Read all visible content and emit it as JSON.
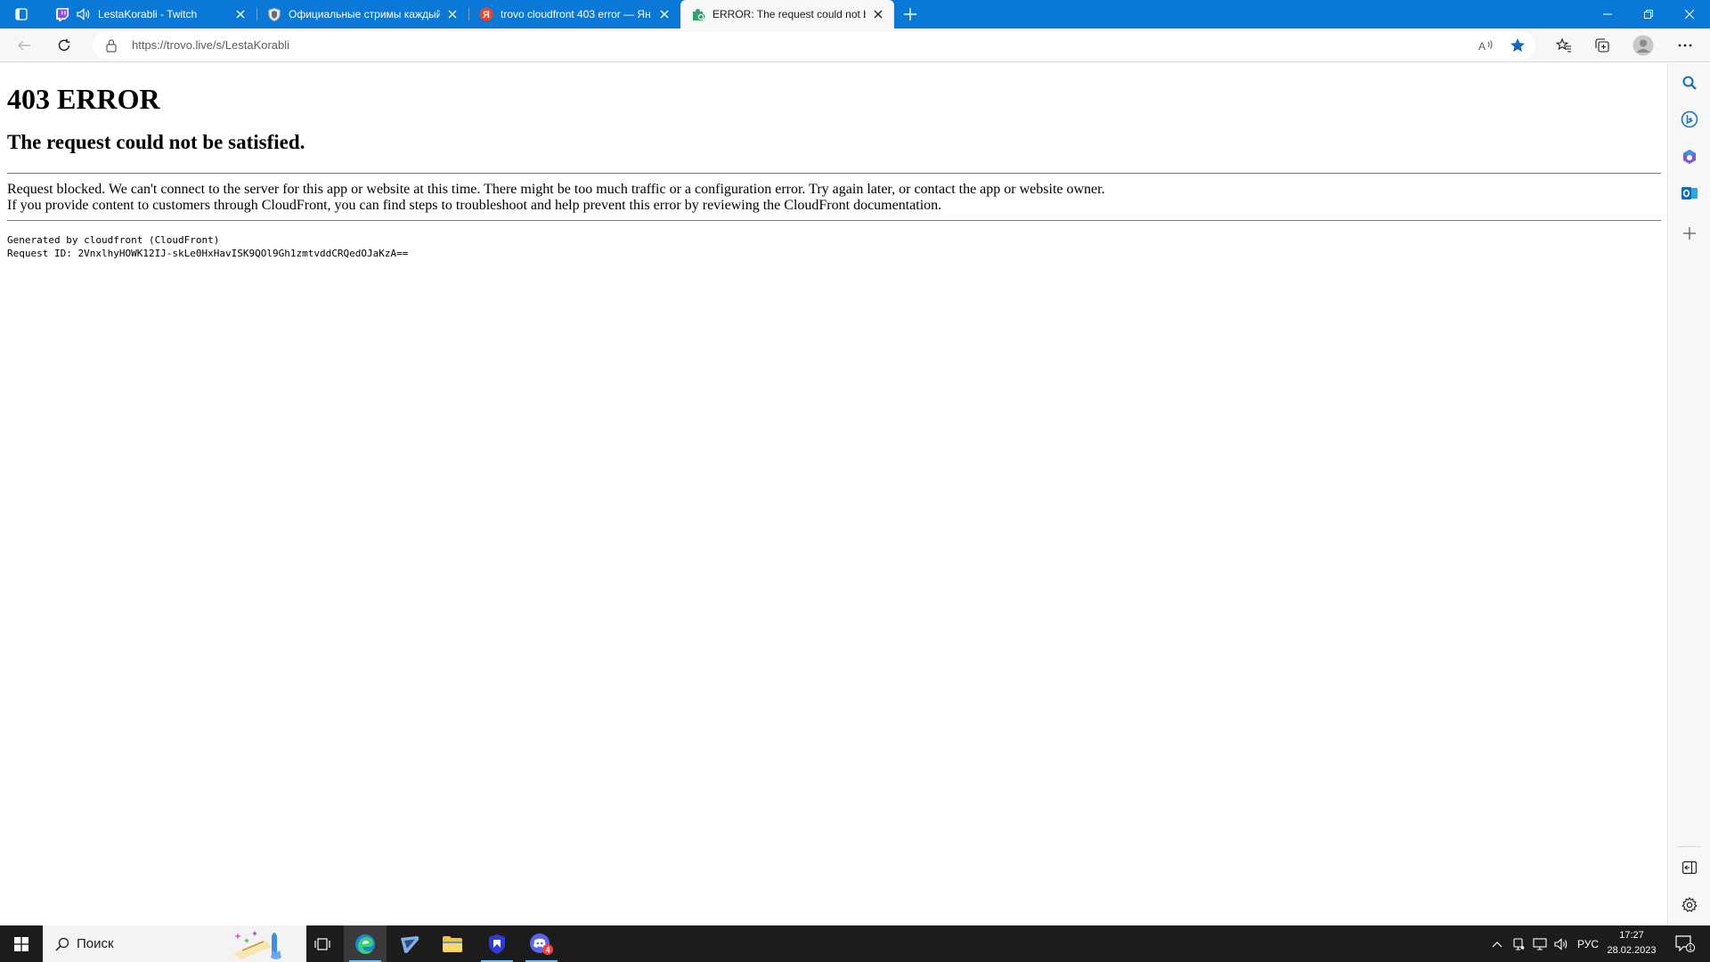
{
  "browser": {
    "tabs": [
      {
        "title": "LestaKorabli - Twitch",
        "favicon": "twitch-icon",
        "audio": true,
        "active": false
      },
      {
        "title": "Официальные стримы каждый",
        "favicon": "shield-icon",
        "audio": false,
        "active": false
      },
      {
        "title": "trovo cloudfront 403 error — Ян",
        "favicon": "yandex-icon",
        "audio": false,
        "active": false
      },
      {
        "title": "ERROR: The request could not be",
        "favicon": "puzzle-icon",
        "audio": false,
        "active": true
      }
    ],
    "address": {
      "url": "https://trovo.live/s/LestaKorabli"
    },
    "colors": {
      "accent": "#0a78d7",
      "toolbar": "#f7f7f7",
      "favorite_star": "#0f6cbd"
    }
  },
  "page": {
    "heading": "403 ERROR",
    "subheading": "The request could not be satisfied.",
    "message_line1": "Request blocked. We can't connect to the server for this app or website at this time. There might be too much traffic or a configuration error. Try again later, or contact the app or website owner.",
    "message_line2": "If you provide content to customers through CloudFront, you can find steps to troubleshoot and help prevent this error by reviewing the CloudFront documentation.",
    "generated_by": "Generated by cloudfront (CloudFront)",
    "request_id": "Request ID: 2VnxlhyHOWK12IJ-skLe0HxHavISK9QOl9Gh1zmtvddCRQedOJaKzA=="
  },
  "taskbar": {
    "search_placeholder": "Поиск",
    "language": "РУС",
    "time": "17:27",
    "date": "28.02.2023",
    "notification_count": "1",
    "discord_badge": "4"
  }
}
